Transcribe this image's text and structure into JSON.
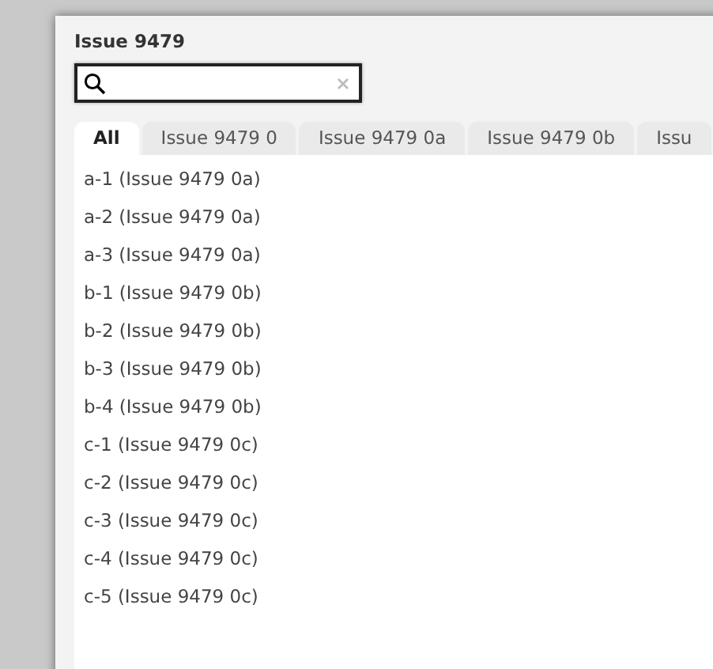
{
  "window": {
    "title": "Issue 9479"
  },
  "tabs": [
    {
      "label": "All",
      "selected": true
    },
    {
      "label": "Issue 9479 0",
      "selected": false
    },
    {
      "label": "Issue 9479 0a",
      "selected": false
    },
    {
      "label": "Issue 9479 0b",
      "selected": false
    },
    {
      "label": "Issu",
      "selected": false
    }
  ],
  "items": [
    "a-1 (Issue 9479 0a)",
    "a-2 (Issue 9479 0a)",
    "a-3 (Issue 9479 0a)",
    "b-1 (Issue 9479 0b)",
    "b-2 (Issue 9479 0b)",
    "b-3 (Issue 9479 0b)",
    "b-4 (Issue 9479 0b)",
    "c-1 (Issue 9479 0c)",
    "c-2 (Issue 9479 0c)",
    "c-3 (Issue 9479 0c)",
    "c-4 (Issue 9479 0c)",
    "c-5 (Issue 9479 0c)"
  ]
}
